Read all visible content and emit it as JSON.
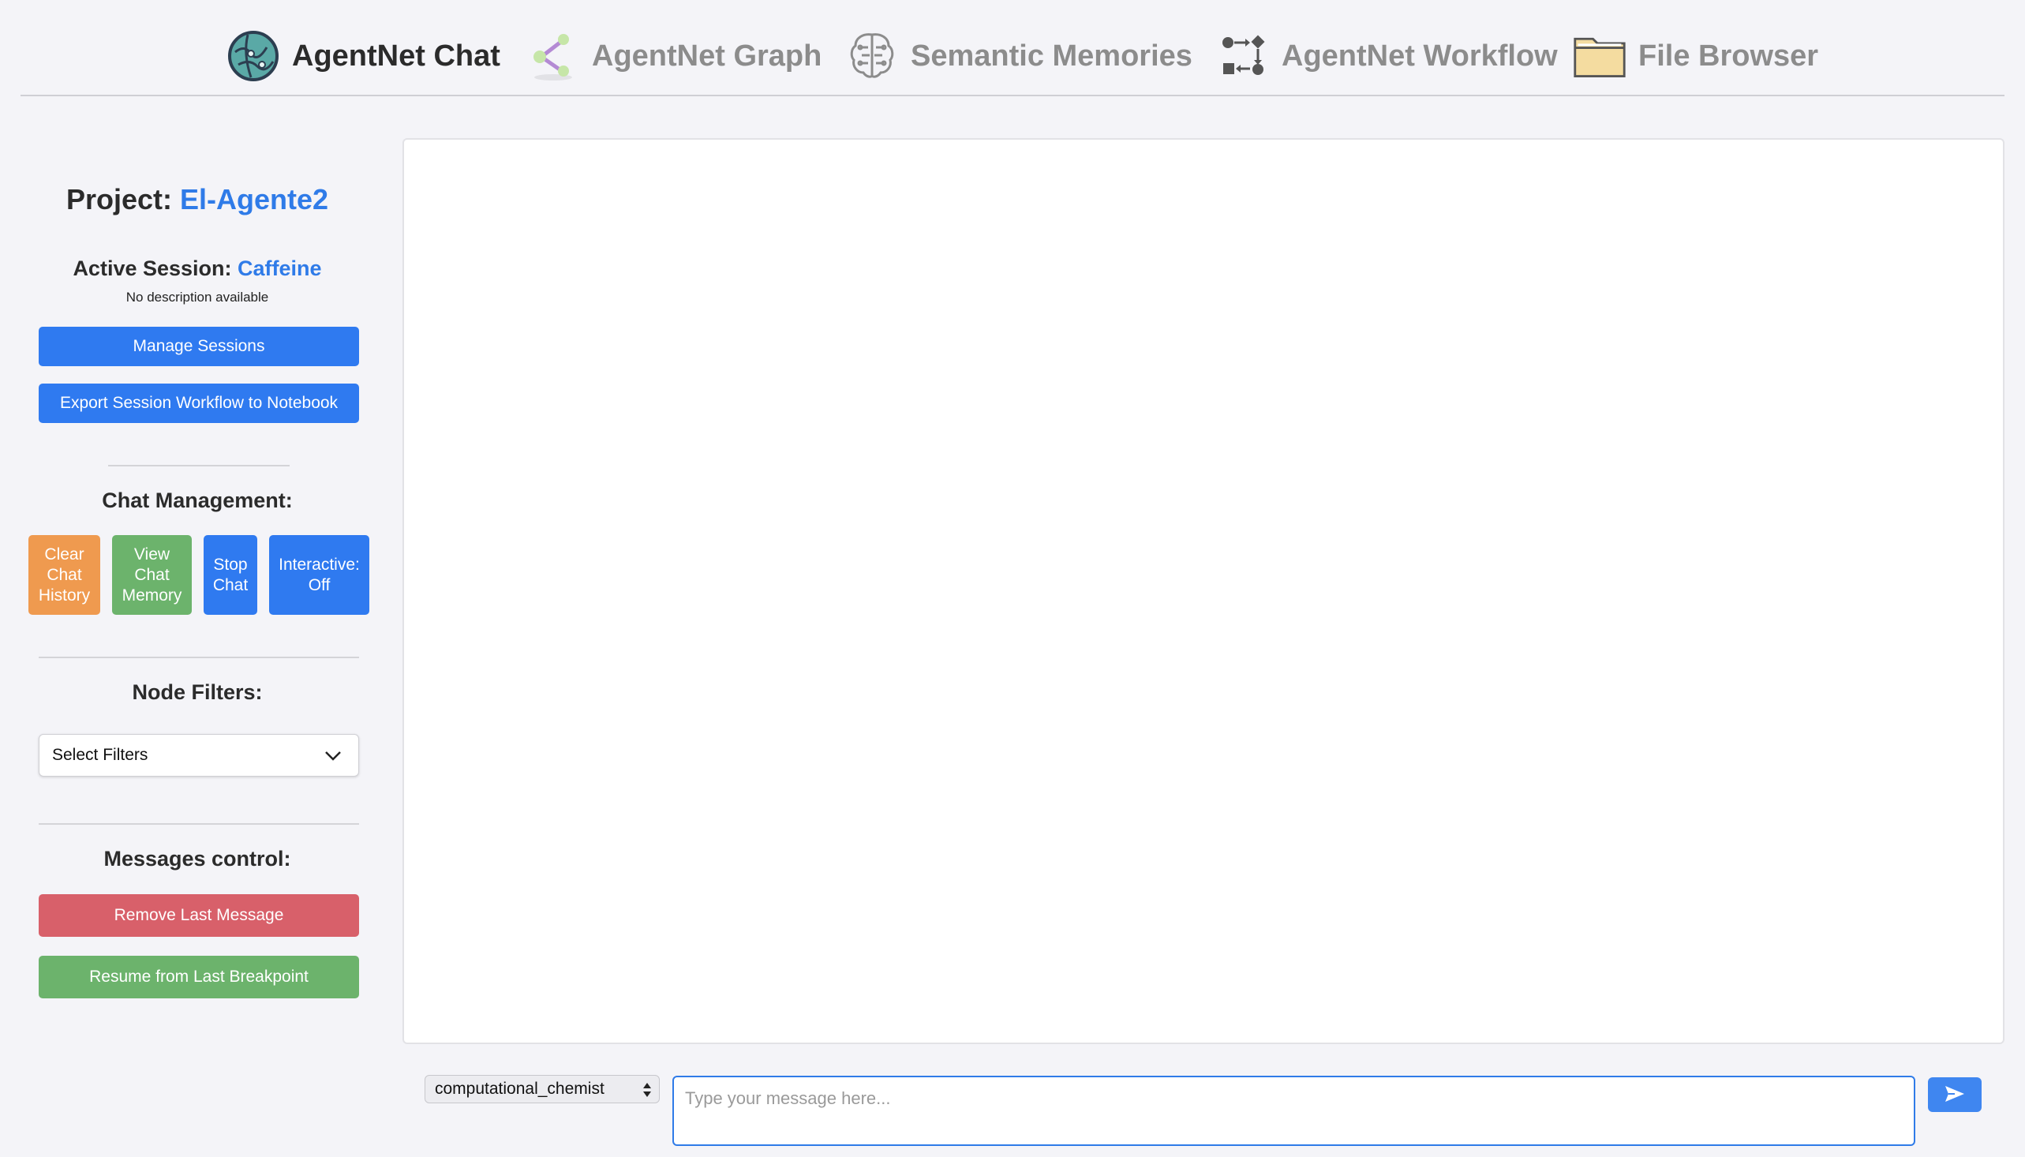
{
  "nav": {
    "items": [
      {
        "label": "AgentNet Chat",
        "icon": "globe-network-icon",
        "active": true
      },
      {
        "label": "AgentNet Graph",
        "icon": "share-graph-icon",
        "active": false
      },
      {
        "label": "Semantic Memories",
        "icon": "brain-circuit-icon",
        "active": false
      },
      {
        "label": "AgentNet Workflow",
        "icon": "workflow-icon",
        "active": false
      },
      {
        "label": "File Browser",
        "icon": "folder-icon",
        "active": false
      }
    ]
  },
  "sidebar": {
    "project_prefix": "Project:",
    "project_name": "El-Agente2",
    "session_prefix": "Active Session:",
    "session_name": "Caffeine",
    "session_description": "No description available",
    "manage_sessions_label": "Manage Sessions",
    "export_label": "Export Session Workflow to Notebook",
    "chat_management_title": "Chat Management:",
    "clear_history_label": "Clear Chat History",
    "view_memory_label": "View Chat Memory",
    "stop_chat_label": "Stop Chat",
    "interactive_label": "Interactive: Off",
    "node_filters_title": "Node Filters:",
    "select_filters_label": "Select Filters",
    "messages_control_title": "Messages control:",
    "remove_last_label": "Remove Last Message",
    "resume_label": "Resume from Last Breakpoint"
  },
  "input_bar": {
    "agent_selected": "computational_chemist",
    "message_placeholder": "Type your message here...",
    "send_icon": "paper-plane-icon"
  },
  "colors": {
    "accent": "#2f7be8",
    "orange": "#ef9a4f",
    "green": "#6cb36c",
    "red": "#d8606a"
  }
}
